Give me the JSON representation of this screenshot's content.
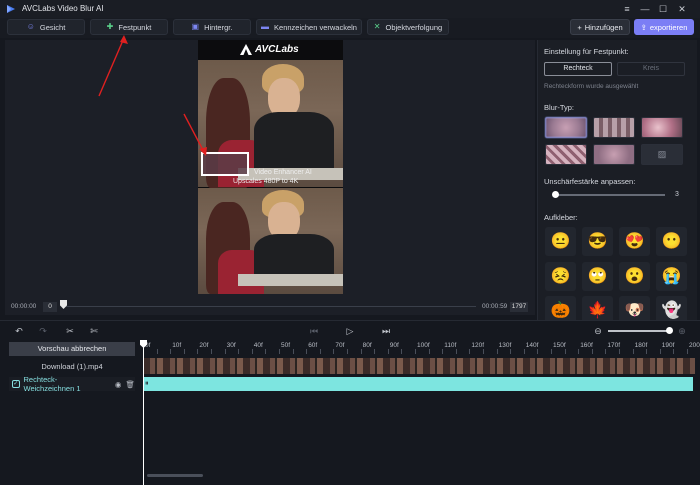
{
  "app": {
    "title": "AVCLabs Video Blur AI"
  },
  "toolbar": {
    "tabs": [
      {
        "label": "Gesicht",
        "icon": "face-icon",
        "color": "#7c86f2"
      },
      {
        "label": "Festpunkt",
        "icon": "crosshair-icon",
        "color": "#5ad08a"
      },
      {
        "label": "Hintergr.",
        "icon": "background-icon",
        "color": "#7c86f2"
      },
      {
        "label": "Kennzeichen verwackeln",
        "icon": "license-plate-icon",
        "color": "#7c86f2"
      },
      {
        "label": "Objektverfolgung",
        "icon": "object-tracking-icon",
        "color": "#5ad08a"
      }
    ],
    "add_label": "Hinzufügen",
    "export_label": "exportieren"
  },
  "preview": {
    "logo_text": "AVCLabs",
    "watermark_line1": "Video Enhancer AI",
    "watermark_line2": "Upscales 480P to 4K",
    "time_start": "00:00:00",
    "frame_current": "0",
    "time_end": "00:00:59",
    "frame_total": "1797"
  },
  "right_panel": {
    "heading": "Einstellung für Festpunkt:",
    "shape_rect": "Rechteck",
    "shape_circle": "Kreis",
    "hint": "Rechteckform wurde ausgewählt",
    "blur_type_label": "Blur-Typ:",
    "strength_label": "Unschärfestärke anpassen:",
    "strength_value": "3",
    "strength_fraction": 0.0,
    "sticker_label": "Aufkleber:",
    "stickers": [
      "😐",
      "😎",
      "😍",
      "😶",
      "😣",
      "🙄",
      "😮",
      "😭",
      "🎃",
      "🍁",
      "🐶",
      "👻"
    ]
  },
  "timeline": {
    "stop_preview_label": "Vorschau abbrechen",
    "file_name": "Download (1).mp4",
    "layer_name": "Rechteck-Weichzeichnen 1",
    "ruler_ticks": [
      "0f",
      "10f",
      "20f",
      "30f",
      "40f",
      "50f",
      "60f",
      "70f",
      "80f",
      "90f",
      "100f",
      "110f",
      "120f",
      "130f",
      "140f",
      "150f",
      "160f",
      "170f",
      "180f",
      "190f",
      "200"
    ]
  },
  "colors": {
    "accent": "#7b7ef5",
    "mask": "#7de5e0",
    "annotation_arrow": "#e02020"
  }
}
